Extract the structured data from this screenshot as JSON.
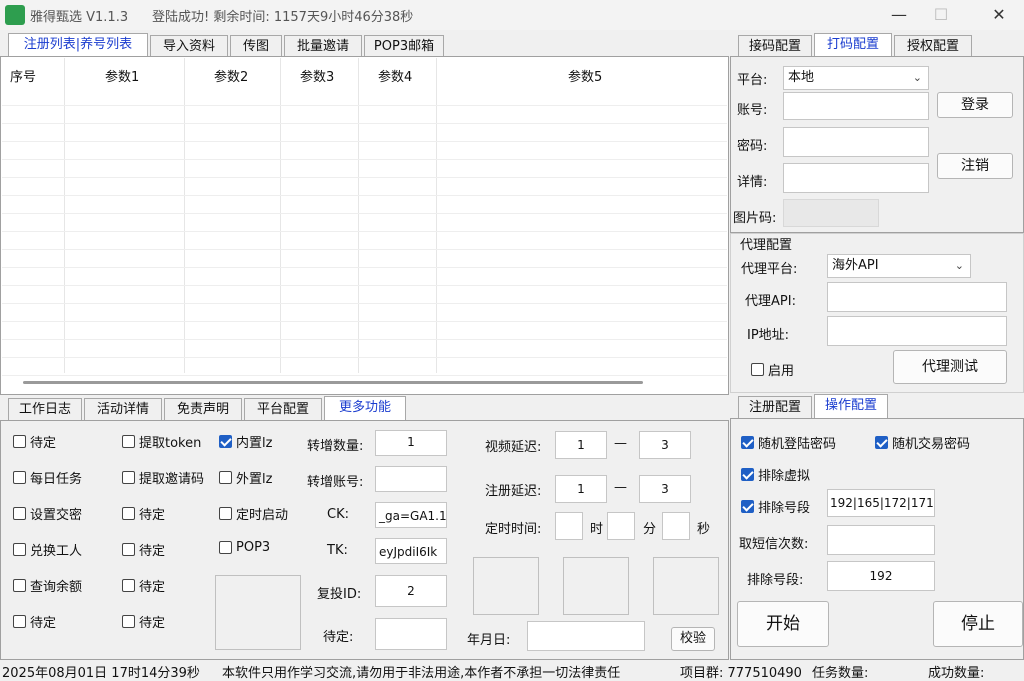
{
  "window": {
    "title": "雅得甄选 V1.1.3",
    "login_status": "登陆成功! 剩余时间: 1157天9小时46分38秒",
    "min": "—",
    "max": "☐",
    "close": "✕"
  },
  "top_tabs": [
    "注册列表|养号列表",
    "导入资料",
    "传图",
    "批量邀请",
    "POP3邮箱"
  ],
  "table": {
    "headers": [
      "序号",
      "参数1",
      "参数2",
      "参数3",
      "参数4",
      "参数5"
    ]
  },
  "bottom_tabs": [
    "工作日志",
    "活动详情",
    "免责声明",
    "平台配置",
    "更多功能"
  ],
  "features": {
    "col1": [
      {
        "label": "待定",
        "checked": false
      },
      {
        "label": "每日任务",
        "checked": false
      },
      {
        "label": "设置交密",
        "checked": false
      },
      {
        "label": "兑换工人",
        "checked": false
      },
      {
        "label": "查询余额",
        "checked": false
      },
      {
        "label": "待定",
        "checked": false
      }
    ],
    "col2": [
      {
        "label": "提取token",
        "checked": false
      },
      {
        "label": "提取邀请码",
        "checked": false
      },
      {
        "label": "待定",
        "checked": false
      },
      {
        "label": "待定",
        "checked": false
      },
      {
        "label": "待定",
        "checked": false
      },
      {
        "label": "待定",
        "checked": false
      }
    ],
    "col3": [
      {
        "label": "内置lz",
        "checked": true
      },
      {
        "label": "外置lz",
        "checked": false
      },
      {
        "label": "定时启动",
        "checked": false
      },
      {
        "label": "POP3",
        "checked": false
      }
    ],
    "zengzeng_count_label": "转增数量:",
    "zengzeng_count": "1",
    "zengzeng_account_label": "转增账号:",
    "zengzeng_account": "",
    "ck_label": "CK:",
    "ck_value": "_ga=GA1.1.",
    "tk_label": "TK:",
    "tk_value": "eyJpdiI6Ik",
    "reinvest_label": "复投ID:",
    "reinvest_value": "2",
    "pending_label": "待定:",
    "pending_value": "",
    "video_delay_label": "视频延迟:",
    "video_delay_min": "1",
    "video_delay_max": "3",
    "reg_delay_label": "注册延迟:",
    "reg_delay_min": "1",
    "reg_delay_max": "3",
    "dash": "—",
    "timer_label": "定时时间:",
    "hour_unit": "时",
    "minute_unit": "分",
    "second_unit": "秒",
    "date_label": "年月日:",
    "verify_button": "校验"
  },
  "right_top_tabs": [
    "接码配置",
    "打码配置",
    "授权配置"
  ],
  "captcha": {
    "platform_label": "平台:",
    "platform_value": "本地",
    "account_label": "账号:",
    "password_label": "密码:",
    "detail_label": "详情:",
    "image_code_label": "图片码:",
    "login_button": "登录",
    "logout_button": "注销"
  },
  "proxy": {
    "group_title": "代理配置",
    "platform_label": "代理平台:",
    "platform_value": "海外API",
    "api_label": "代理API:",
    "ip_label": "IP地址:",
    "enable_label": "启用",
    "enable_checked": false,
    "test_button": "代理测试"
  },
  "right_bottom_tabs": [
    "注册配置",
    "操作配置"
  ],
  "operation": {
    "random_login_pwd": "随机登陆密码",
    "random_trade_pwd": "随机交易密码",
    "exclude_virtual": "排除虚拟",
    "exclude_segment": "排除号段",
    "exclude_segment_value": "192|165|172|171",
    "sms_count_label": "取短信次数:",
    "sms_count_value": "",
    "exclude_segment2_label": "排除号段:",
    "exclude_segment2_value": "192",
    "start_button": "开始",
    "stop_button": "停止"
  },
  "status": {
    "datetime": "2025年08月01日 17时14分39秒",
    "disclaimer": "本软件只用作学习交流,请勿用于非法用途,本作者不承担一切法律责任",
    "group": "项目群: 777510490",
    "task_count": "任务数量:",
    "success_count": "成功数量:"
  },
  "colors": {
    "active_tab": "#1a3ccf",
    "check_blue": "#1f5fc5",
    "app_icon": "#2e9e4f"
  }
}
